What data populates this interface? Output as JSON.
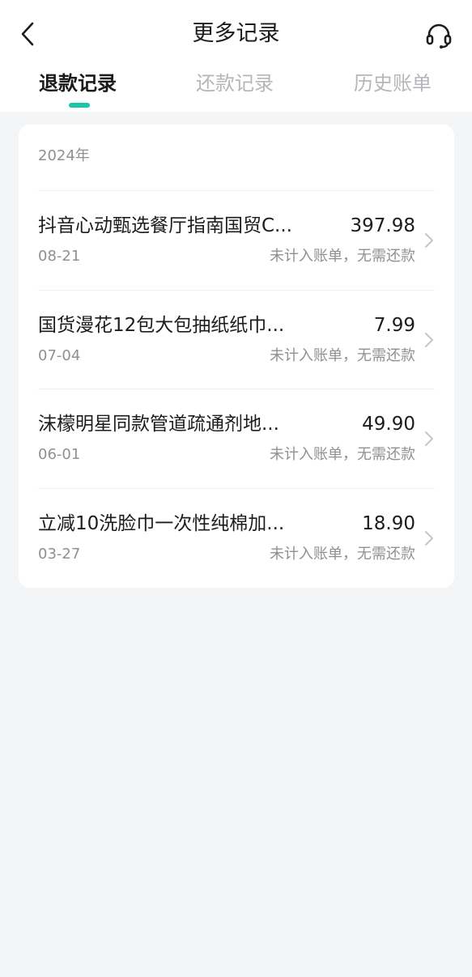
{
  "header": {
    "title": "更多记录",
    "back_icon": "chevron-left-icon",
    "support_icon": "headset-icon"
  },
  "tabs": [
    {
      "label": "退款记录",
      "active": true
    },
    {
      "label": "还款记录",
      "active": false
    },
    {
      "label": "历史账单",
      "active": false
    }
  ],
  "colors": {
    "accent": "#18c7a8",
    "background": "#f4f5f6",
    "text_primary": "#1c1c1c",
    "text_secondary": "#8e9094",
    "tab_inactive": "#b4b6b9"
  },
  "records": {
    "year": "2024年",
    "items": [
      {
        "title": "抖音心动甄选餐厅指南国贸C...",
        "amount": "397.98",
        "date": "08-21",
        "status": "未计入账单，无需还款"
      },
      {
        "title": "国货漫花12包大包抽纸纸巾...",
        "amount": "7.99",
        "date": "07-04",
        "status": "未计入账单，无需还款"
      },
      {
        "title": "沫檬明星同款管道疏通剂地...",
        "amount": "49.90",
        "date": "06-01",
        "status": "未计入账单，无需还款"
      },
      {
        "title": "立减10洗脸巾一次性纯棉加...",
        "amount": "18.90",
        "date": "03-27",
        "status": "未计入账单，无需还款"
      }
    ]
  }
}
